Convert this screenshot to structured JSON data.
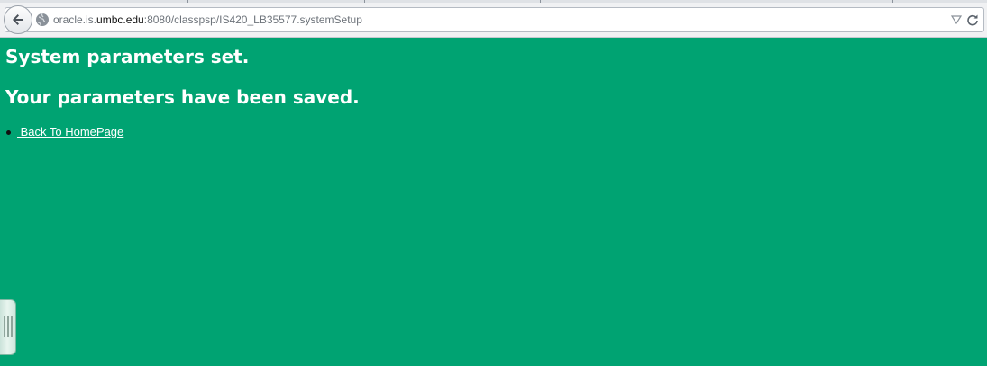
{
  "browser": {
    "address_bar": {
      "url_prefix": "oracle.is.",
      "url_domain": "umbc.edu",
      "url_suffix": ":8080/classpsp/IS420_LB35577.systemSetup"
    },
    "icons": {
      "back": "back-arrow-icon",
      "site": "globe-icon",
      "dropdown": "dropdown-arrow-icon",
      "reload": "reload-icon",
      "sidebar": "sidebar-grip-icon"
    }
  },
  "page": {
    "background_color": "#00a372",
    "heading_1": "System parameters set.",
    "heading_2": "Your parameters have been saved.",
    "links": [
      {
        "label": " Back To HomePage"
      }
    ]
  }
}
